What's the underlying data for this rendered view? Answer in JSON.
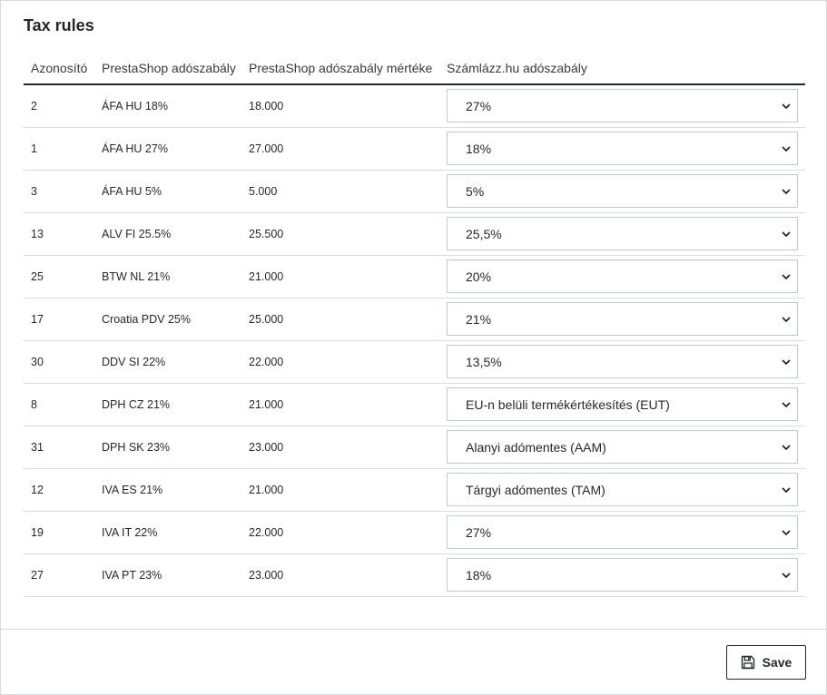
{
  "panel": {
    "title": "Tax rules"
  },
  "table": {
    "headers": [
      "Azonosító",
      "PrestaShop adószabály",
      "PrestaShop adószabály mértéke",
      "Számlázz.hu adószabály"
    ],
    "rows": [
      {
        "id": "2",
        "rule": "ÁFA HU 18%",
        "rate": "18.000",
        "szamlazz": "27%"
      },
      {
        "id": "1",
        "rule": "ÁFA HU 27%",
        "rate": "27.000",
        "szamlazz": "18%"
      },
      {
        "id": "3",
        "rule": "ÁFA HU 5%",
        "rate": "5.000",
        "szamlazz": "5%"
      },
      {
        "id": "13",
        "rule": "ALV FI 25.5%",
        "rate": "25.500",
        "szamlazz": "25,5%"
      },
      {
        "id": "25",
        "rule": "BTW NL 21%",
        "rate": "21.000",
        "szamlazz": "20%"
      },
      {
        "id": "17",
        "rule": "Croatia PDV 25%",
        "rate": "25.000",
        "szamlazz": "21%"
      },
      {
        "id": "30",
        "rule": "DDV SI 22%",
        "rate": "22.000",
        "szamlazz": "13,5%"
      },
      {
        "id": "8",
        "rule": "DPH CZ 21%",
        "rate": "21.000",
        "szamlazz": "EU-n belüli termékértékesítés (EUT)"
      },
      {
        "id": "31",
        "rule": "DPH SK 23%",
        "rate": "23.000",
        "szamlazz": "Alanyi adómentes (AAM)"
      },
      {
        "id": "12",
        "rule": "IVA ES 21%",
        "rate": "21.000",
        "szamlazz": "Tárgyi adómentes (TAM)"
      },
      {
        "id": "19",
        "rule": "IVA IT 22%",
        "rate": "22.000",
        "szamlazz": "27%"
      },
      {
        "id": "27",
        "rule": "IVA PT 23%",
        "rate": "23.000",
        "szamlazz": "18%"
      }
    ]
  },
  "footer": {
    "save_label": "Save",
    "save_icon": "floppy-disk-icon"
  }
}
